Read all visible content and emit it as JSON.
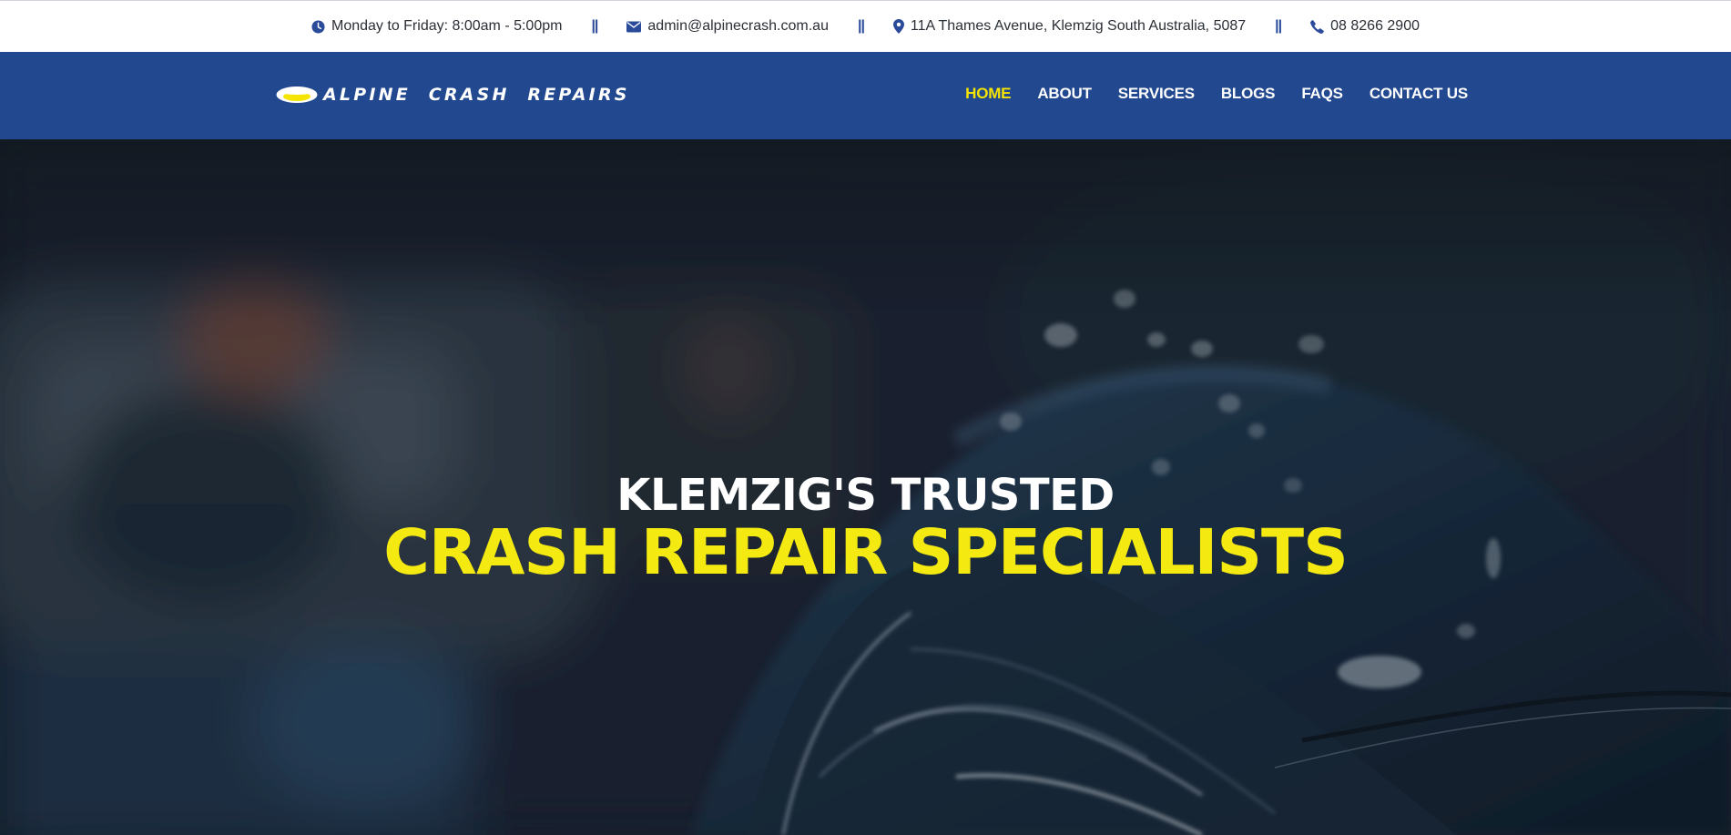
{
  "topbar": {
    "hours": "Monday to Friday: 8:00am - 5:00pm",
    "email": "admin@alpinecrash.com.au",
    "address": "11A Thames Avenue, Klemzig South Australia, 5087",
    "phone": "08 8266 2900",
    "separator": "||",
    "icons": [
      "clock-icon",
      "envelope-icon",
      "map-pin-icon",
      "phone-icon"
    ]
  },
  "brand": {
    "name": "ALPINE CRASH REPAIRS"
  },
  "nav": {
    "items": [
      {
        "label": "HOME",
        "active": true
      },
      {
        "label": "ABOUT"
      },
      {
        "label": "SERVICES"
      },
      {
        "label": "BLOGS"
      },
      {
        "label": "FAQS"
      },
      {
        "label": "CONTACT US"
      }
    ]
  },
  "hero": {
    "line1": "KLEMZIG'S TRUSTED",
    "line2": "CRASH REPAIR SPECIALISTS"
  },
  "colors": {
    "nav_background": "#22488f",
    "accent_yellow": "#f4e400",
    "icon_blue": "#2a4a9a",
    "hero_dark": "#162533"
  }
}
